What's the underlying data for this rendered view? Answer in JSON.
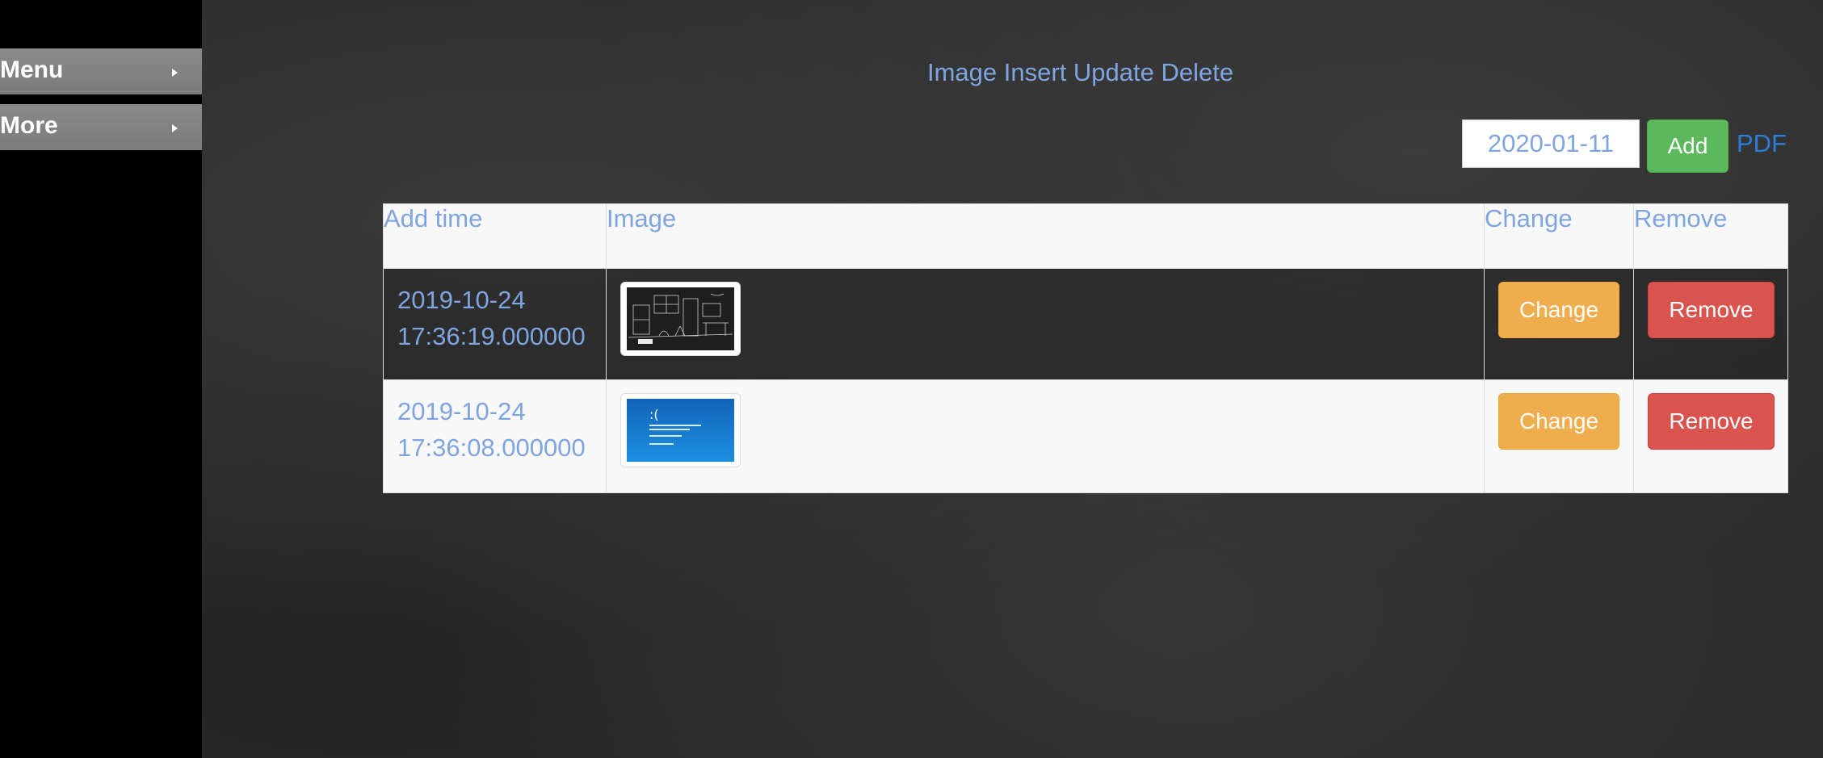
{
  "sidebar": {
    "items": [
      {
        "label": "Menu"
      },
      {
        "label": "More"
      }
    ]
  },
  "header": {
    "title": "Image Insert Update Delete"
  },
  "toolbar": {
    "date_value": "2020-01-11",
    "add_label": "Add",
    "pdf_label": "PDF"
  },
  "table": {
    "columns": [
      "Add time",
      "Image",
      "Change",
      "Remove"
    ],
    "rows": [
      {
        "date": "2019-10-24",
        "time": "17:36:19.000000",
        "image_icon": "chalk-sketch-thumbnail",
        "change_label": "Change",
        "remove_label": "Remove"
      },
      {
        "date": "2019-10-24",
        "time": "17:36:08.000000",
        "image_icon": "blue-screen-thumbnail",
        "thumb_text": ":(",
        "change_label": "Change",
        "remove_label": "Remove"
      }
    ]
  },
  "colors": {
    "accent_text": "#7fa5e0",
    "add_button": "#5cb85c",
    "change_button": "#f0ad4e",
    "remove_button": "#d9534f",
    "pdf_link": "#2f7bd8",
    "sidebar_bg": "#000000"
  }
}
